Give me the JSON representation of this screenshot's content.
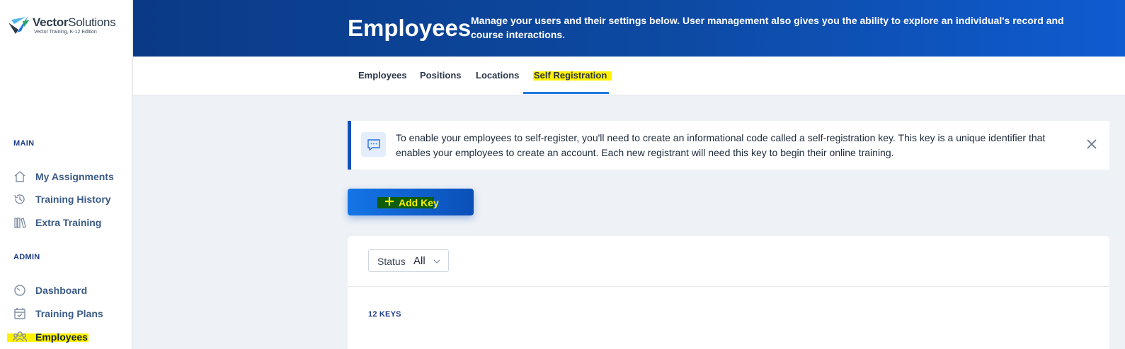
{
  "brand": {
    "name_bold": "Vector",
    "name_light": "Solutions",
    "tagline": "Vector Training, K-12 Edition"
  },
  "sidebar": {
    "main_title": "MAIN",
    "main_items": [
      {
        "label": "My Assignments",
        "icon": "home-icon"
      },
      {
        "label": "Training History",
        "icon": "history-icon"
      },
      {
        "label": "Extra Training",
        "icon": "books-icon"
      }
    ],
    "admin_title": "ADMIN",
    "admin_items": [
      {
        "label": "Dashboard",
        "icon": "gauge-icon"
      },
      {
        "label": "Training Plans",
        "icon": "calendar-check-icon"
      },
      {
        "label": "Employees",
        "icon": "people-icon",
        "active": true
      }
    ]
  },
  "header": {
    "title": "Employees",
    "description": "Manage your users and their settings below. User management also gives you the ability to explore an individual's record and course interactions."
  },
  "tabs": [
    {
      "label": "Employees"
    },
    {
      "label": "Positions"
    },
    {
      "label": "Locations"
    },
    {
      "label": "Self Registration",
      "active": true
    }
  ],
  "banner": {
    "text": "To enable your employees to self-register, you'll need to create an informational code called a self-registration key. This key is a unique identifier that enables your employees to create an account. Each new registrant will need this key to begin their online training.",
    "icon": "chat-icon"
  },
  "add_button": {
    "label": "Add Key"
  },
  "filter": {
    "label": "Status",
    "value": "All"
  },
  "keys_count": "12 KEYS",
  "colors": {
    "header_start": "#0a3a86",
    "header_end": "#0f5bd0",
    "accent": "#1f78e0",
    "highlight": "#fff200"
  }
}
